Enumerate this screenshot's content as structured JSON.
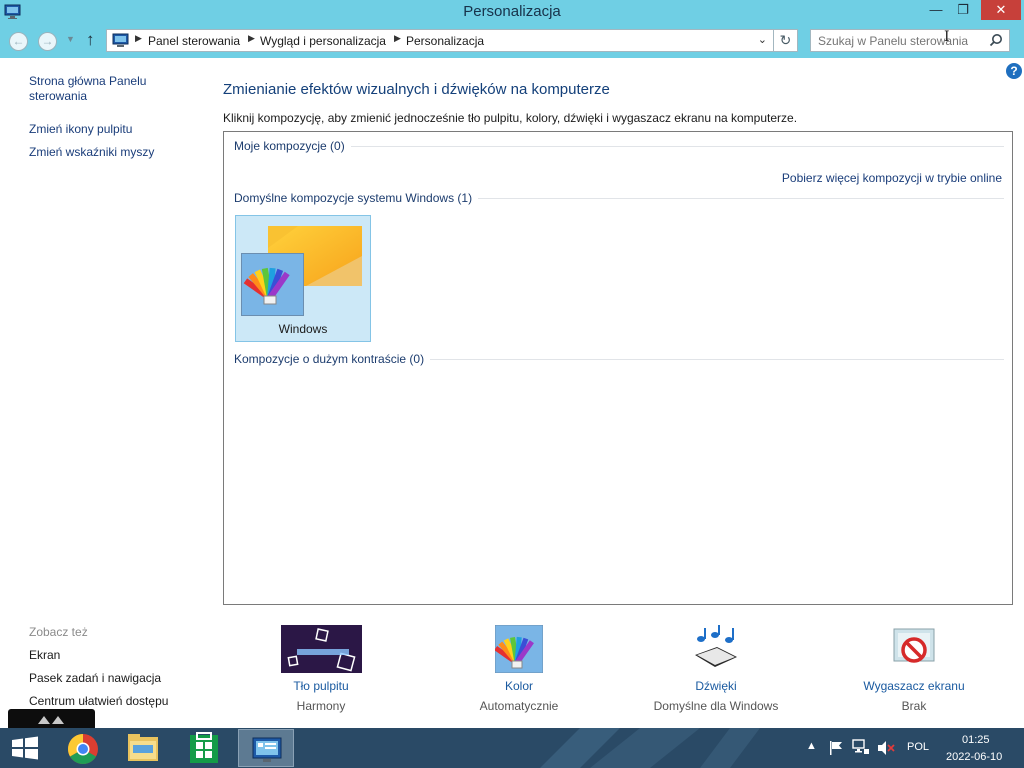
{
  "window": {
    "title": "Personalizacja",
    "controls": {
      "minimize": "—",
      "maximize": "❐",
      "close": "✕"
    }
  },
  "address": {
    "crumbs": [
      "Panel sterowania",
      "Wygląd i personalizacja",
      "Personalizacja"
    ],
    "search_placeholder": "Szukaj w Panelu sterowania"
  },
  "sidebar": {
    "home": "Strona główna Panelu sterowania",
    "links": [
      "Zmień ikony pulpitu",
      "Zmień wskaźniki myszy"
    ],
    "see_also_title": "Zobacz też",
    "see_also": [
      "Ekran",
      "Pasek zadań i nawigacja",
      "Centrum ułatwień dostępu"
    ]
  },
  "main": {
    "heading": "Zmienianie efektów wizualnych i dźwięków na komputerze",
    "description": "Kliknij kompozycję, aby zmienić jednocześnie tło pulpitu, kolory, dźwięki i wygaszacz ekranu na komputerze.",
    "groups": {
      "my_themes": "Moje kompozycje (0)",
      "online_link": "Pobierz więcej kompozycji w trybie online",
      "default_themes": "Domyślne kompozycje systemu Windows (1)",
      "high_contrast": "Kompozycje o dużym kontraście (0)"
    },
    "themes": [
      {
        "name": "Windows",
        "selected": true
      }
    ]
  },
  "bottom_items": [
    {
      "label": "Tło pulpitu",
      "value": "Harmony",
      "icon": "desktop-background-icon"
    },
    {
      "label": "Kolor",
      "value": "Automatycznie",
      "icon": "color-icon"
    },
    {
      "label": "Dźwięki",
      "value": "Domyślne dla Windows",
      "icon": "sounds-icon"
    },
    {
      "label": "Wygaszacz ekranu",
      "value": "Brak",
      "icon": "screensaver-icon"
    }
  ],
  "taskbar": {
    "pinned": [
      "start-icon",
      "chrome-icon",
      "file-explorer-icon",
      "store-icon",
      "control-panel-icon"
    ],
    "language": "POL",
    "time": "01:25",
    "date": "2022-06-10"
  },
  "colors": {
    "title_bar": "#6fcfe4",
    "link": "#1a3d7a",
    "selected_theme": "#cce8f7",
    "close_button": "#c7403a",
    "taskbar": "#2a4a66"
  }
}
